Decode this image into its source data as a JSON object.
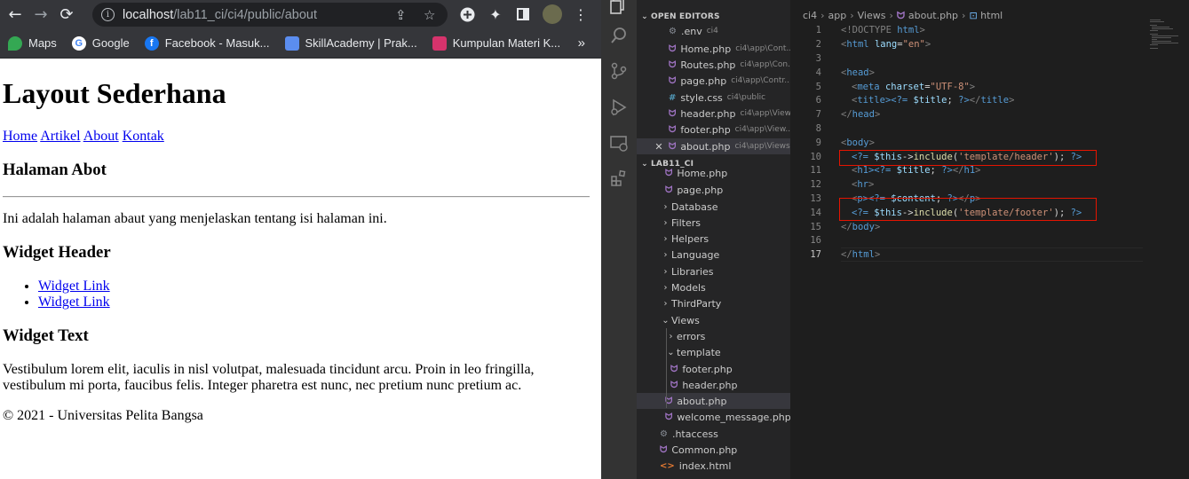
{
  "browser": {
    "url_host": "localhost",
    "url_path": "/lab11_ci/ci4/public/about",
    "bookmarks": [
      "Maps",
      "Google",
      "Facebook - Masuk...",
      "SkillAcademy | Prak...",
      "Kumpulan Materi K..."
    ],
    "more": "»"
  },
  "page": {
    "title": "Layout Sederhana",
    "nav": [
      "Home",
      "Artikel",
      "About",
      "Kontak"
    ],
    "heading": "Halaman Abot",
    "content": "Ini adalah halaman abaut yang menjelaskan tentang isi halaman ini.",
    "widget_header": "Widget Header",
    "widget_links": [
      "Widget Link",
      "Widget Link"
    ],
    "widget_text_title": "Widget Text",
    "widget_text": "Vestibulum lorem elit, iaculis in nisl volutpat, malesuada tincidunt arcu. Proin in leo fringilla, vestibulum mi porta, faucibus felis. Integer pharetra est nunc, nec pretium nunc pretium ac.",
    "footer": "© 2021 - Universitas Pelita Bangsa"
  },
  "vscode": {
    "open_editors_title": "OPEN EDITORS",
    "open_editors": [
      {
        "name": ".env",
        "path": "ci4"
      },
      {
        "name": "Home.php",
        "path": "ci4\\app\\Cont..."
      },
      {
        "name": "Routes.php",
        "path": "ci4\\app\\Con..."
      },
      {
        "name": "page.php",
        "path": "ci4\\app\\Contr..."
      },
      {
        "name": "style.css",
        "path": "ci4\\public"
      },
      {
        "name": "header.php",
        "path": "ci4\\app\\View..."
      },
      {
        "name": "footer.php",
        "path": "ci4\\app\\View..."
      },
      {
        "name": "about.php",
        "path": "ci4\\app\\Views"
      }
    ],
    "project_title": "LAB11_CI",
    "tree": [
      "Home.php",
      "page.php",
      "Database",
      "Filters",
      "Helpers",
      "Language",
      "Libraries",
      "Models",
      "ThirdParty",
      "Views",
      "errors",
      "template",
      "footer.php",
      "header.php",
      "about.php",
      "welcome_message.php",
      ".htaccess",
      "Common.php",
      "index.html"
    ],
    "breadcrumb": [
      "ci4",
      "app",
      "Views",
      "about.php",
      "html"
    ],
    "line_numbers": [
      "1",
      "2",
      "3",
      "4",
      "5",
      "6",
      "7",
      "8",
      "9",
      "10",
      "11",
      "12",
      "13",
      "14",
      "15",
      "16",
      "17"
    ],
    "code": {
      "l1a": "<!DOCTYPE",
      "l1b": " html",
      "l1c": ">",
      "l2a": "<",
      "l2b": "html",
      "l2c": " lang",
      "l2d": "=",
      "l2e": "\"en\"",
      "l2f": ">",
      "l4a": "<",
      "l4b": "head",
      "l4c": ">",
      "l5a": "<",
      "l5b": "meta",
      "l5c": " charset",
      "l5d": "=",
      "l5e": "\"UTF-8\"",
      "l5f": ">",
      "l6a": "<",
      "l6b": "title",
      "l6c": "><?= ",
      "l6d": "$title",
      "l6e": "; ",
      "l6f": "?>",
      "l6g": "</",
      "l6h": "title",
      "l6i": ">",
      "l7a": "</",
      "l7b": "head",
      "l7c": ">",
      "l9a": "<",
      "l9b": "body",
      "l9c": ">",
      "l10a": "<?= ",
      "l10b": "$this",
      "l10c": "->",
      "l10d": "include",
      "l10e": "(",
      "l10f": "'template/header'",
      "l10g": "); ",
      "l10h": "?>",
      "l11a": "<",
      "l11b": "h1",
      "l11c": "><?= ",
      "l11d": "$title",
      "l11e": "; ",
      "l11f": "?>",
      "l11g": "</",
      "l11h": "h1",
      "l11i": ">",
      "l12a": "<",
      "l12b": "hr",
      "l12c": ">",
      "l13a": "<",
      "l13b": "p",
      "l13c": "><?= ",
      "l13d": "$content",
      "l13e": "; ",
      "l13f": "?>",
      "l13g": "</",
      "l13h": "p",
      "l13i": ">",
      "l14a": "<?= ",
      "l14b": "$this",
      "l14c": "->",
      "l14d": "include",
      "l14e": "(",
      "l14f": "'template/footer'",
      "l14g": "); ",
      "l14h": "?>",
      "l15a": "</",
      "l15b": "body",
      "l15c": ">",
      "l17a": "</",
      "l17b": "html",
      "l17c": ">"
    }
  },
  "colors": {
    "chrome_bar": "#35363a",
    "link": "#0000ee",
    "vscode_bg": "#1e1e1e",
    "highlight_box": "#e51400"
  }
}
